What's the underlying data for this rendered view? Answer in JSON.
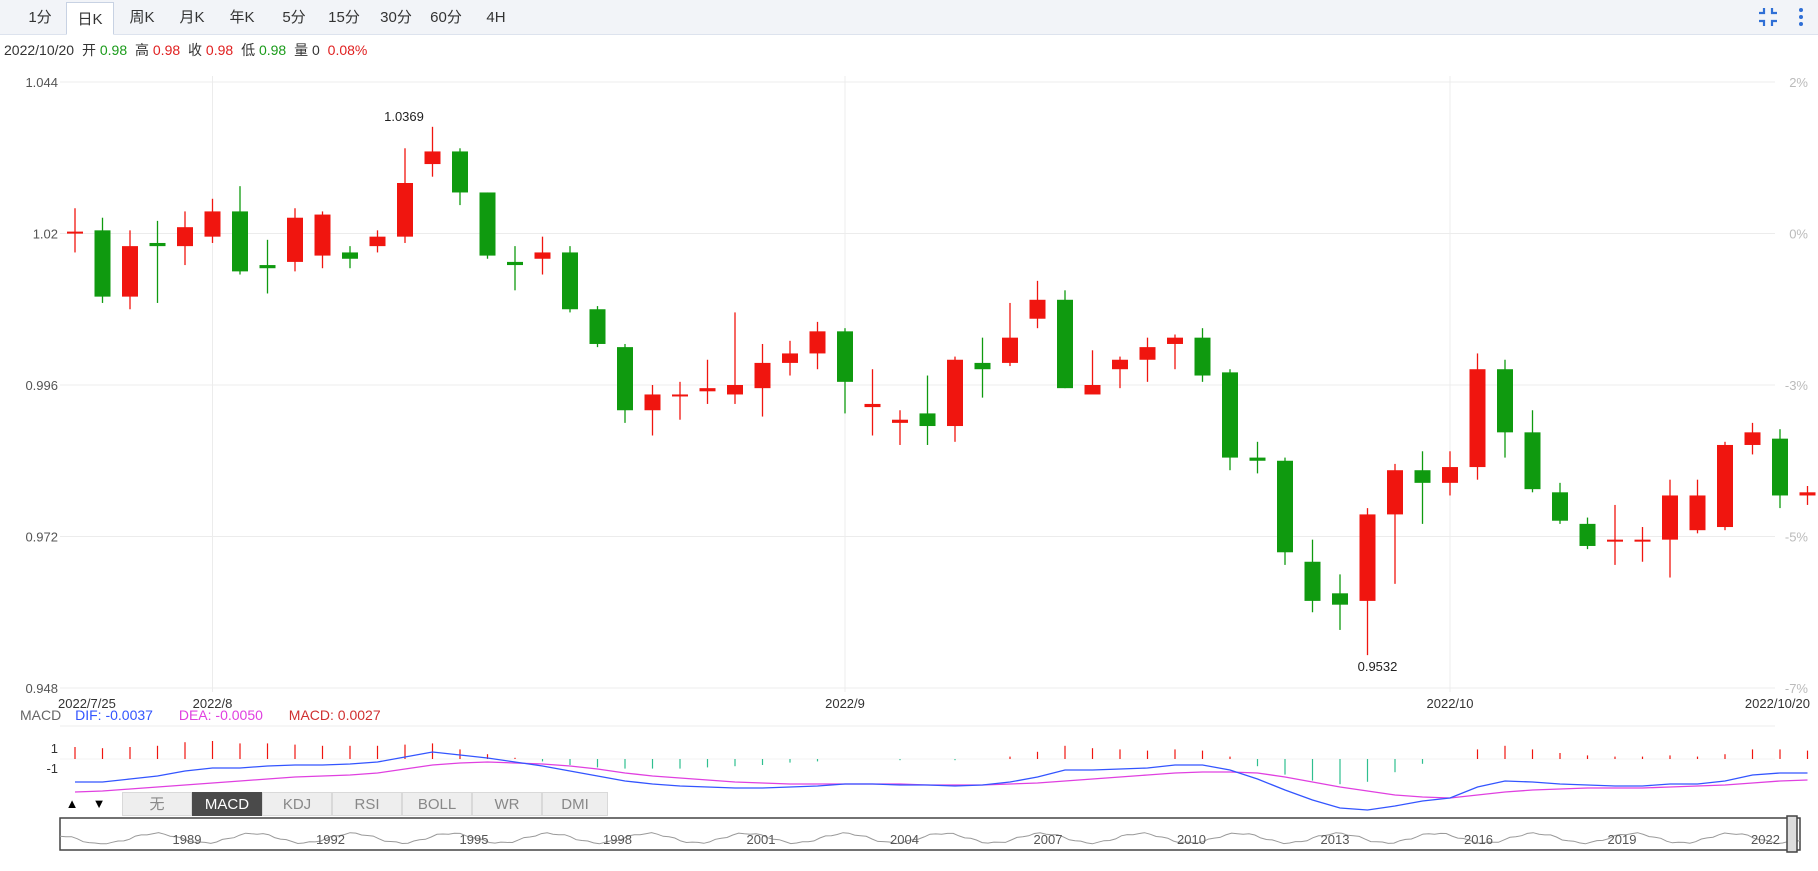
{
  "tabs": [
    {
      "label": "1分",
      "active": false
    },
    {
      "label": "日K",
      "active": true
    },
    {
      "label": "周K",
      "active": false
    },
    {
      "label": "月K",
      "active": false
    },
    {
      "label": "年K",
      "active": false
    },
    {
      "label": "5分",
      "active": false
    },
    {
      "label": "15分",
      "active": false
    },
    {
      "label": "30分",
      "active": false
    },
    {
      "label": "60分",
      "active": false
    },
    {
      "label": "4H",
      "active": false
    }
  ],
  "toolbar": {
    "collapse_icon": "collapse-icon",
    "more_icon": "more-vertical-icon"
  },
  "info": {
    "date": "2022/10/20",
    "open_label": "开",
    "open": "0.98",
    "high_label": "高",
    "high": "0.98",
    "close_label": "收",
    "close": "0.98",
    "low_label": "低",
    "low": "0.98",
    "vol_label": "量",
    "vol": "0",
    "change": "0.08%"
  },
  "colors": {
    "up": "#f0150f",
    "down": "#0f9a0f",
    "dif": "#3355ff",
    "dea": "#e040e0",
    "macd": "#d03030",
    "grid": "#ececec"
  },
  "chart_data": {
    "type": "candlestick",
    "y_ticks": [
      "1.044",
      "1.02",
      "0.996",
      "0.972",
      "0.948"
    ],
    "ylim": [
      0.948,
      1.044
    ],
    "pct_ticks": [
      "2%",
      "0%",
      "-3%",
      "-5%",
      "-7%"
    ],
    "x_labels": [
      {
        "label": "2022/7/25",
        "index": 0
      },
      {
        "label": "2022/8",
        "index": 5
      },
      {
        "label": "2022/9",
        "index": 28
      },
      {
        "label": "2022/10",
        "index": 50
      },
      {
        "label": "2022/10/20",
        "index": 63
      }
    ],
    "max_label": "1.0369",
    "max_index": 12,
    "min_label": "0.9532",
    "min_index": 47,
    "candles": [
      [
        1.0203,
        1.0203,
        1.024,
        1.017
      ],
      [
        1.0205,
        1.01,
        1.0225,
        1.009
      ],
      [
        1.01,
        1.018,
        1.0205,
        1.008
      ],
      [
        1.0185,
        1.018,
        1.022,
        1.009
      ],
      [
        1.018,
        1.021,
        1.0235,
        1.015
      ],
      [
        1.0195,
        1.0235,
        1.0255,
        1.0185
      ],
      [
        1.0235,
        1.014,
        1.0275,
        1.0135
      ],
      [
        1.015,
        1.0145,
        1.019,
        1.0105
      ],
      [
        1.0155,
        1.0225,
        1.024,
        1.014
      ],
      [
        1.0165,
        1.023,
        1.0235,
        1.0145
      ],
      [
        1.017,
        1.016,
        1.018,
        1.0145
      ],
      [
        1.018,
        1.0195,
        1.0205,
        1.017
      ],
      [
        1.0195,
        1.028,
        1.0335,
        1.0185
      ],
      [
        1.031,
        1.033,
        1.0369,
        1.029
      ],
      [
        1.033,
        1.0265,
        1.0335,
        1.0245
      ],
      [
        1.0265,
        1.0165,
        1.0265,
        1.016
      ],
      [
        1.0155,
        1.015,
        1.018,
        1.011
      ],
      [
        1.016,
        1.017,
        1.0195,
        1.0135
      ],
      [
        1.017,
        1.008,
        1.018,
        1.0075
      ],
      [
        1.008,
        1.0025,
        1.0085,
        1.002
      ],
      [
        1.002,
        0.992,
        1.0025,
        0.99
      ],
      [
        0.992,
        0.9945,
        0.996,
        0.988
      ],
      [
        0.9945,
        0.9945,
        0.9965,
        0.9905
      ],
      [
        0.995,
        0.9955,
        1.0,
        0.993
      ],
      [
        0.9945,
        0.996,
        1.0075,
        0.993
      ],
      [
        0.9955,
        0.9995,
        1.0025,
        0.991
      ],
      [
        0.9995,
        1.001,
        1.003,
        0.9975
      ],
      [
        1.001,
        1.0045,
        1.006,
        0.9985
      ],
      [
        1.0045,
        0.9965,
        1.005,
        0.9915
      ],
      [
        0.9925,
        0.993,
        0.9985,
        0.988
      ],
      [
        0.99,
        0.9905,
        0.992,
        0.9865
      ],
      [
        0.9915,
        0.9895,
        0.9975,
        0.9865
      ],
      [
        0.9895,
        1.0,
        1.0005,
        0.987
      ],
      [
        0.9995,
        0.9985,
        1.0035,
        0.994
      ],
      [
        0.9995,
        1.0035,
        1.009,
        0.999
      ],
      [
        1.0065,
        1.0095,
        1.0125,
        1.005
      ],
      [
        1.0095,
        0.9955,
        1.011,
        0.9955
      ],
      [
        0.9945,
        0.996,
        1.0015,
        0.995
      ],
      [
        0.9985,
        1.0,
        1.0005,
        0.9955
      ],
      [
        1.0,
        1.002,
        1.0035,
        0.9965
      ],
      [
        1.0025,
        1.0035,
        1.004,
        0.9985
      ],
      [
        1.0035,
        0.9975,
        1.005,
        0.9965
      ],
      [
        0.998,
        0.9845,
        0.9985,
        0.9825
      ],
      [
        0.9845,
        0.984,
        0.987,
        0.982
      ],
      [
        0.984,
        0.9695,
        0.9845,
        0.9675
      ],
      [
        0.968,
        0.9618,
        0.9715,
        0.96
      ],
      [
        0.963,
        0.9612,
        0.966,
        0.9572
      ],
      [
        0.9618,
        0.9755,
        0.9765,
        0.9532
      ],
      [
        0.9755,
        0.9825,
        0.9835,
        0.9645
      ],
      [
        0.9825,
        0.9805,
        0.9855,
        0.974
      ],
      [
        0.9805,
        0.983,
        0.9855,
        0.9785
      ],
      [
        0.983,
        0.9985,
        1.001,
        0.981
      ],
      [
        0.9985,
        0.9885,
        1.0,
        0.9845
      ],
      [
        0.9885,
        0.9795,
        0.992,
        0.979
      ],
      [
        0.979,
        0.9745,
        0.9805,
        0.974
      ],
      [
        0.974,
        0.9705,
        0.975,
        0.97
      ],
      [
        0.9715,
        0.9715,
        0.977,
        0.9675
      ],
      [
        0.9715,
        0.9715,
        0.9735,
        0.968
      ],
      [
        0.9715,
        0.9785,
        0.981,
        0.9655
      ],
      [
        0.973,
        0.9785,
        0.981,
        0.9725
      ],
      [
        0.9735,
        0.9865,
        0.987,
        0.973
      ],
      [
        0.9865,
        0.9885,
        0.99,
        0.985
      ],
      [
        0.9875,
        0.9785,
        0.989,
        0.9765
      ],
      [
        0.9785,
        0.979,
        0.98,
        0.977
      ]
    ],
    "macd": {
      "label": "MACD",
      "dif_label": "DIF: -0.0037",
      "dea_label": "DEA: -0.0050",
      "macd_label": "MACD: 0.0027",
      "y_ticks": [
        "1",
        "-1"
      ],
      "dif": [
        -0.9,
        -0.9,
        -0.6,
        -0.3,
        0.2,
        0.5,
        0.5,
        0.7,
        0.8,
        0.8,
        0.9,
        1.1,
        1.6,
        2.1,
        1.8,
        1.5,
        1.1,
        0.7,
        0.2,
        -0.3,
        -0.8,
        -1.1,
        -1.3,
        -1.4,
        -1.5,
        -1.5,
        -1.4,
        -1.3,
        -1.1,
        -1.1,
        -1.2,
        -1.2,
        -1.3,
        -1.2,
        -0.9,
        -0.4,
        0.3,
        0.3,
        0.4,
        0.5,
        0.8,
        0.8,
        0.3,
        -0.6,
        -1.7,
        -2.7,
        -3.5,
        -3.7,
        -3.3,
        -2.8,
        -2.5,
        -1.4,
        -0.8,
        -0.9,
        -1.1,
        -1.2,
        -1.3,
        -1.3,
        -1.1,
        -1.1,
        -0.8,
        -0.2,
        0.0,
        0.0
      ],
      "dea": [
        -1.9,
        -1.8,
        -1.6,
        -1.4,
        -1.2,
        -1.0,
        -0.8,
        -0.6,
        -0.4,
        -0.3,
        -0.2,
        0.0,
        0.4,
        0.8,
        1.0,
        1.1,
        1.0,
        0.9,
        0.7,
        0.4,
        0.0,
        -0.3,
        -0.5,
        -0.7,
        -0.9,
        -1.0,
        -1.1,
        -1.1,
        -1.1,
        -1.1,
        -1.1,
        -1.2,
        -1.2,
        -1.2,
        -1.1,
        -1.0,
        -0.8,
        -0.6,
        -0.4,
        -0.2,
        0.0,
        0.1,
        0.1,
        0.0,
        -0.4,
        -0.9,
        -1.4,
        -1.8,
        -2.2,
        -2.4,
        -2.5,
        -2.2,
        -1.9,
        -1.7,
        -1.6,
        -1.5,
        -1.5,
        -1.5,
        -1.4,
        -1.3,
        -1.2,
        -1.0,
        -0.8,
        -0.7
      ]
    },
    "nav": {
      "years": [
        "1989",
        "1992",
        "1995",
        "1998",
        "2001",
        "2004",
        "2007",
        "2010",
        "2013",
        "2016",
        "2019",
        "2022"
      ]
    }
  },
  "indicator_tabs": [
    "无",
    "MACD",
    "KDJ",
    "RSI",
    "BOLL",
    "WR",
    "DMI"
  ],
  "indicator_active": "MACD",
  "arrows": {
    "up": "▲",
    "down": "▼"
  }
}
